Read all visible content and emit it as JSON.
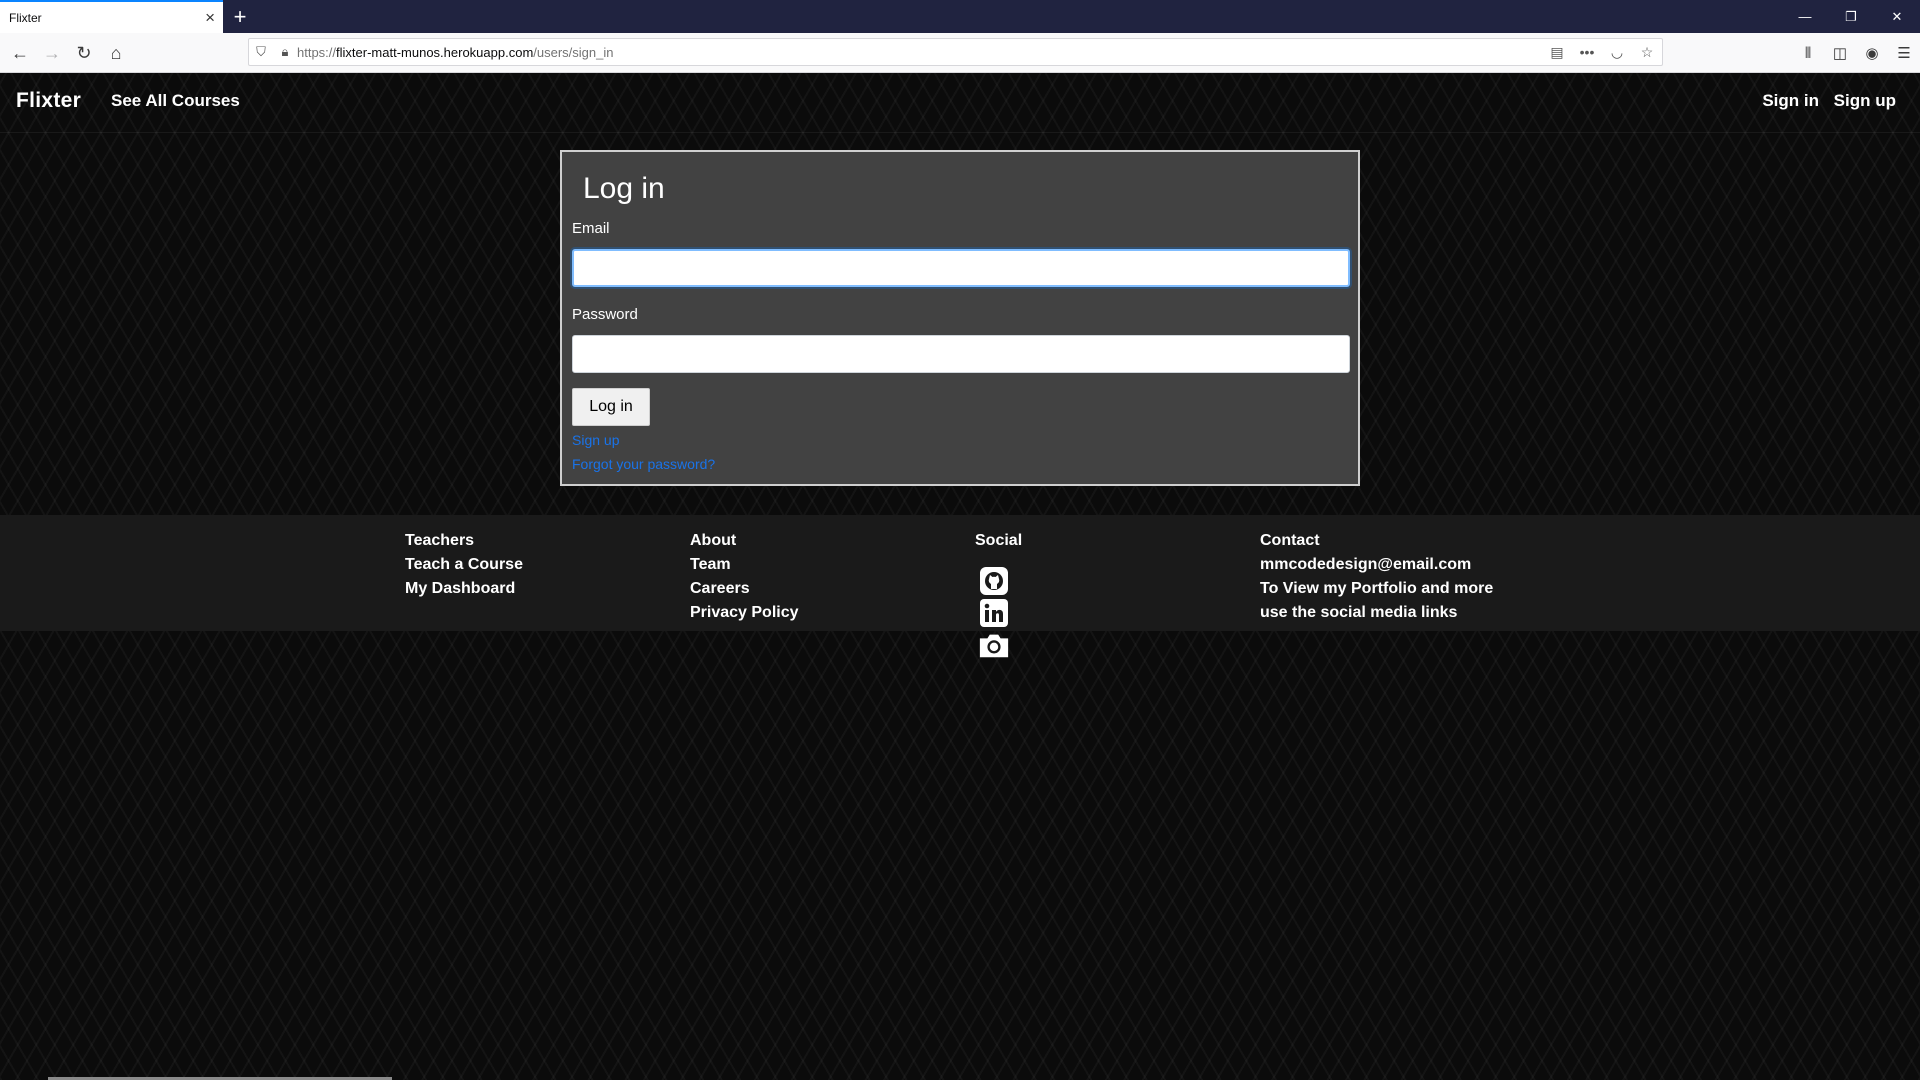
{
  "browser": {
    "tab_title": "Flixter",
    "url_scheme": "https://",
    "url_host": "flixter-matt-munos.herokuapp.com",
    "url_path": "/users/sign_in"
  },
  "site_header": {
    "brand": "Flixter",
    "see_all": "See All Courses",
    "sign_in": "Sign in",
    "sign_up": "Sign up"
  },
  "login": {
    "title": "Log in",
    "email_label": "Email",
    "email_value": "",
    "password_label": "Password",
    "password_value": "",
    "submit_label": "Log in",
    "signup_link": "Sign up",
    "forgot_link": "Forgot your password?"
  },
  "footer": {
    "teachers": {
      "heading": "Teachers",
      "items": [
        "Teach a Course",
        "My Dashboard"
      ]
    },
    "about": {
      "heading": "About",
      "items": [
        "Team",
        "Careers",
        "Privacy Policy"
      ]
    },
    "social": {
      "heading": "Social",
      "icons": [
        "github-icon",
        "linkedin-icon",
        "camera-icon"
      ]
    },
    "contact": {
      "heading": "Contact",
      "email": "mmcodedesign@email.com",
      "note_line1": "To View my Portfolio and more",
      "note_line2": "use the social media links"
    }
  },
  "colors": {
    "page_bg": "#0b0b0b",
    "card_bg": "#424242",
    "footer_bg": "#1a1a1a",
    "link": "#1a73e8",
    "tabstrip": "#202340"
  }
}
